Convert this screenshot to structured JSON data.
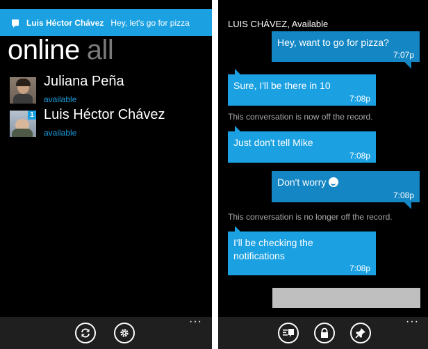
{
  "left": {
    "toast": {
      "sender": "Luis Héctor Chávez",
      "message": "Hey, let's go for pizza"
    },
    "pivot": {
      "active": "online",
      "inactive": "all"
    },
    "contacts": [
      {
        "name": "Juliana Peña",
        "status": "available",
        "badge": ""
      },
      {
        "name": "Luis Héctor Chávez",
        "status": "available",
        "badge": "1"
      }
    ],
    "appbar": {
      "buttons": [
        "refresh-icon",
        "gear-icon"
      ],
      "more": "···"
    }
  },
  "right": {
    "header": "LUIS CHÁVEZ, Available",
    "messages": [
      {
        "direction": "sent",
        "text": "Hey, want to go for pizza?",
        "time": "7:07p"
      },
      {
        "direction": "received",
        "text": "Sure, I'll be there in 10",
        "time": "7:08p"
      },
      {
        "kind": "system",
        "text": "This conversation is now off the record."
      },
      {
        "direction": "received",
        "text": "Just don't tell Mike",
        "time": "7:08p"
      },
      {
        "direction": "sent",
        "text": "Don't worry",
        "time": "7:08p",
        "emoticon": "smiley-icon"
      },
      {
        "kind": "system",
        "text": "This conversation is no longer off the record."
      },
      {
        "direction": "received",
        "text": "I'll be checking the notifications",
        "time": "7:08p"
      }
    ],
    "appbar": {
      "buttons": [
        "quick-reply-icon",
        "lock-icon",
        "pin-icon"
      ],
      "more": "···"
    }
  },
  "colors": {
    "accent": "#1ba1e2",
    "sent_bubble": "#1486c4",
    "background": "#000000",
    "appbar": "#1f1f1f",
    "compose_box": "#bfbfbf"
  }
}
